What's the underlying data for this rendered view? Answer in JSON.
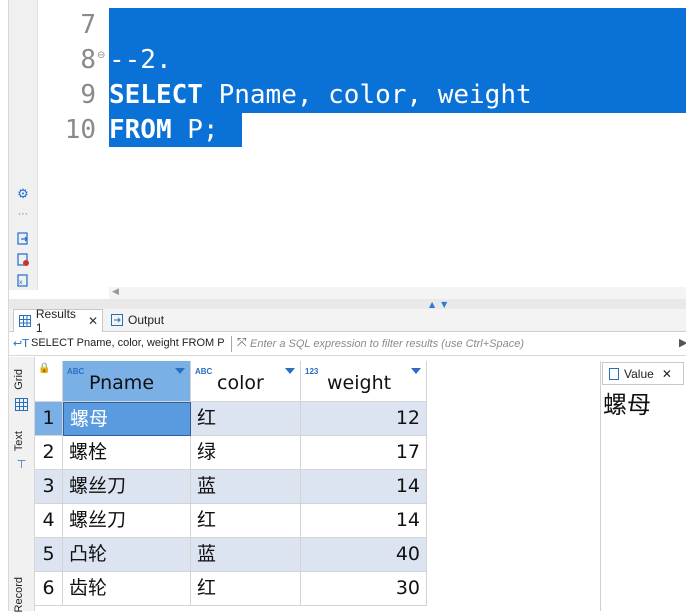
{
  "editor": {
    "line_numbers": [
      "7",
      "8",
      "9",
      "10"
    ],
    "lines": [
      {
        "text": ""
      },
      {
        "text": "--2."
      },
      {
        "keyword": "SELECT",
        "rest": " Pname, color, weight"
      },
      {
        "keyword": "FROM",
        "rest": " P;"
      }
    ]
  },
  "tabs": {
    "results_label": "Results 1",
    "output_label": "Output"
  },
  "filter": {
    "sql_text": "SELECT Pname, color, weight FROM P",
    "placeholder": "Enter a SQL expression to filter results (use Ctrl+Space)"
  },
  "side_tabs": {
    "grid": "Grid",
    "text": "Text",
    "record": "Record"
  },
  "grid": {
    "columns": [
      {
        "name": "Pname",
        "type": "ABC"
      },
      {
        "name": "color",
        "type": "ABC"
      },
      {
        "name": "weight",
        "type": "123"
      }
    ],
    "rows": [
      {
        "num": "1",
        "Pname": "螺母",
        "color": "红",
        "weight": "12"
      },
      {
        "num": "2",
        "Pname": "螺栓",
        "color": "绿",
        "weight": "17"
      },
      {
        "num": "3",
        "Pname": "螺丝刀",
        "color": "蓝",
        "weight": "14"
      },
      {
        "num": "4",
        "Pname": "螺丝刀",
        "color": "红",
        "weight": "14"
      },
      {
        "num": "5",
        "Pname": "凸轮",
        "color": "蓝",
        "weight": "40"
      },
      {
        "num": "6",
        "Pname": "齿轮",
        "color": "红",
        "weight": "30"
      }
    ]
  },
  "value_panel": {
    "tab_label": "Value",
    "value": "螺母"
  },
  "colors": {
    "selection": "#0a72d6",
    "row_band": "#dbe4f0",
    "selected_cell": "#5a9be0"
  }
}
